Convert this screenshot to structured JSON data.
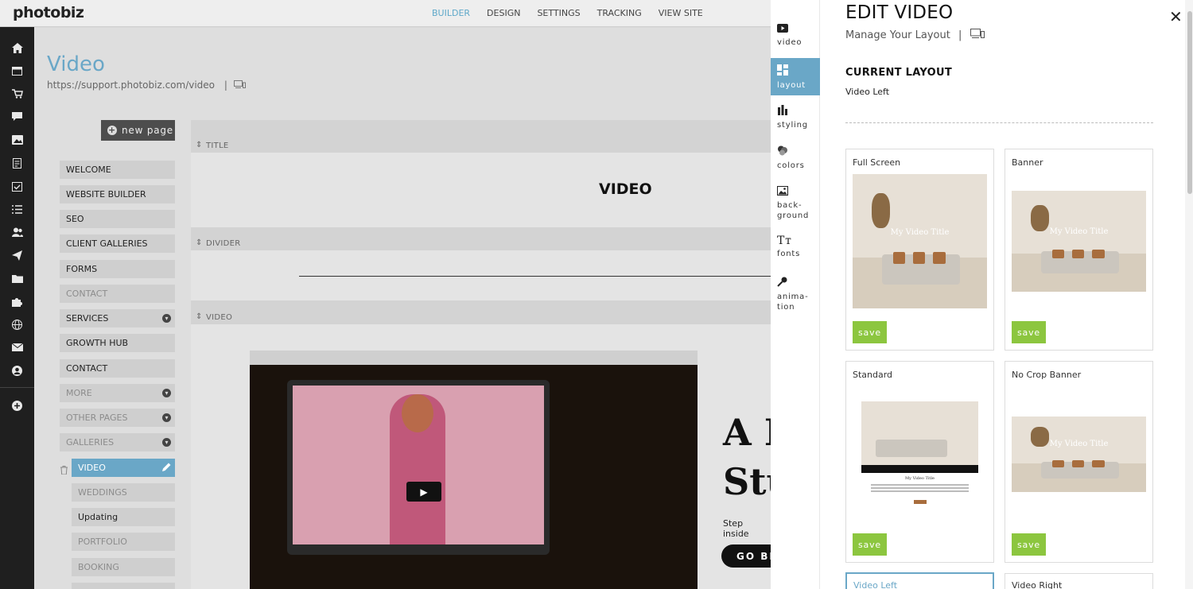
{
  "app": {
    "logo": "photobiz"
  },
  "topnav": [
    {
      "label": "BUILDER",
      "active": true
    },
    {
      "label": "DESIGN",
      "active": false
    },
    {
      "label": "SETTINGS",
      "active": false
    },
    {
      "label": "TRACKING",
      "active": false
    },
    {
      "label": "VIEW SITE",
      "active": false
    }
  ],
  "rail_icons": [
    "home-icon",
    "calendar-icon",
    "cart-icon",
    "chat-icon",
    "image-icon",
    "document-icon",
    "calendar-check-icon",
    "list-icon",
    "contacts-icon",
    "send-icon",
    "folder-icon",
    "puzzle-icon",
    "globe-icon",
    "mail-icon",
    "user-icon",
    "add-icon"
  ],
  "page": {
    "title": "Video",
    "url": "https://support.photobiz.com/video",
    "url_sep": "|",
    "new_page_label": "new page"
  },
  "pages": [
    {
      "label": "WELCOME",
      "muted": false,
      "chevron": false
    },
    {
      "label": "WEBSITE BUILDER",
      "muted": false,
      "chevron": false
    },
    {
      "label": "SEO",
      "muted": false,
      "chevron": false
    },
    {
      "label": "CLIENT GALLERIES",
      "muted": false,
      "chevron": false
    },
    {
      "label": "FORMS",
      "muted": false,
      "chevron": false
    },
    {
      "label": "CONTACT",
      "muted": true,
      "chevron": false
    },
    {
      "label": "SERVICES",
      "muted": false,
      "chevron": true
    },
    {
      "label": "GROWTH HUB",
      "muted": false,
      "chevron": false
    },
    {
      "label": "CONTACT",
      "muted": false,
      "chevron": false
    },
    {
      "label": "MORE",
      "muted": true,
      "chevron": true
    },
    {
      "label": "OTHER PAGES",
      "muted": true,
      "chevron": true
    },
    {
      "label": "GALLERIES",
      "muted": true,
      "chevron": true
    }
  ],
  "subpages": [
    {
      "label": "VIDEO",
      "active": true
    },
    {
      "label": "WEDDINGS",
      "muted": true
    },
    {
      "label": "Updating",
      "muted": false
    },
    {
      "label": "PORTFOLIO",
      "muted": true
    },
    {
      "label": "BOOKING",
      "muted": true
    }
  ],
  "sections": {
    "title_label": "TITLE",
    "title_text": "VIDEO",
    "divider_label": "DIVIDER",
    "video_label": "VIDEO"
  },
  "hero": {
    "line1": "A D",
    "line2": "Stu",
    "sub": "Step inside",
    "button": "GO BE"
  },
  "editor_tabs": [
    {
      "label": "video",
      "icon": "video-icon",
      "active": false
    },
    {
      "label": "layout",
      "icon": "layout-icon",
      "active": true
    },
    {
      "label": "styling",
      "icon": "styling-icon",
      "active": false
    },
    {
      "label": "colors",
      "icon": "colors-icon",
      "active": false
    },
    {
      "label": "back-\nground",
      "icon": "background-icon",
      "active": false
    },
    {
      "label": "fonts",
      "icon": "fonts-icon",
      "active": false
    },
    {
      "label": "anima-\ntion",
      "icon": "animation-icon",
      "active": false
    }
  ],
  "editor": {
    "title": "EDIT VIDEO",
    "subtitle": "Manage Your Layout",
    "subtitle_sep": "|",
    "current_layout_label": "CURRENT LAYOUT",
    "current_layout_value": "Video Left",
    "save_label": "save",
    "layouts": [
      {
        "name": "Full Screen",
        "thumb_title": "My Video Title"
      },
      {
        "name": "Banner",
        "thumb_title": "My Video Title"
      },
      {
        "name": "Standard",
        "thumb_title": "My Video Title"
      },
      {
        "name": "No Crop Banner",
        "thumb_title": "My Video Title"
      },
      {
        "name": "Video Left",
        "selected": true
      },
      {
        "name": "Video Right"
      }
    ]
  },
  "colors": {
    "accent": "#6aa7c7",
    "save_green": "#8cc63f",
    "chat": "#58b9c4"
  }
}
